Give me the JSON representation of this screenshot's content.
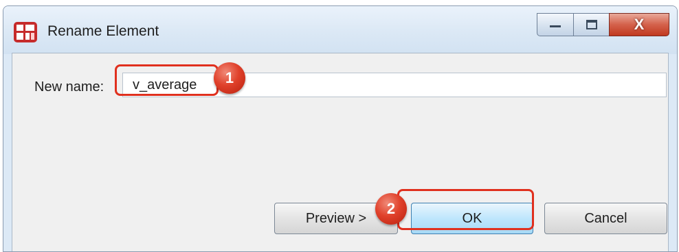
{
  "window": {
    "title": "Rename Element",
    "app_icon": "package-rename-icon",
    "controls": {
      "minimize_icon": "minimize-icon",
      "maximize_icon": "maximize-icon",
      "close_label": "X"
    }
  },
  "form": {
    "label": "New name:",
    "value": "v_average"
  },
  "buttons": {
    "preview": "Preview >",
    "ok": "OK",
    "cancel": "Cancel"
  },
  "annotations": [
    {
      "number": "1",
      "target": "new-name-input"
    },
    {
      "number": "2",
      "target": "ok-button"
    }
  ],
  "colors": {
    "highlight": "#e0301e",
    "ok_button": "#bee6fd"
  }
}
